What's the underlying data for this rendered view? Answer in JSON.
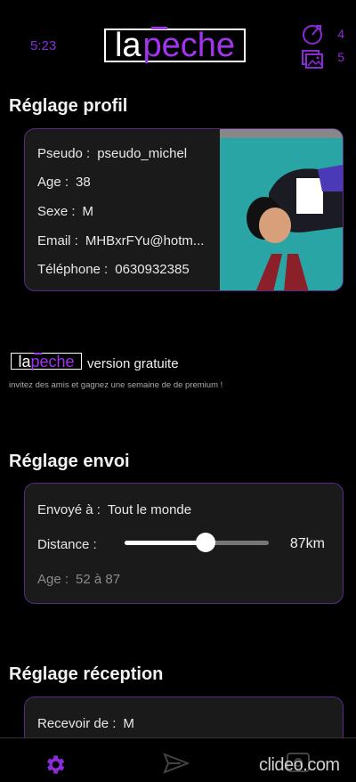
{
  "header": {
    "time": "5:23",
    "logo": {
      "part1": "la",
      "part2": "peche"
    },
    "counters": [
      {
        "icon": "boost-icon",
        "value": "4"
      },
      {
        "icon": "picture-icon",
        "value": "5"
      }
    ]
  },
  "profile": {
    "title": "Réglage profil",
    "fields": [
      {
        "label": "Pseudo :",
        "value": "pseudo_michel"
      },
      {
        "label": "Age :",
        "value": "38"
      },
      {
        "label": "Sexe :",
        "value": "M"
      },
      {
        "label": "Email :",
        "value": "MHBxrFYu@hotm..."
      },
      {
        "label": "Téléphone :",
        "value": "0630932385"
      }
    ]
  },
  "promo": {
    "logo": {
      "part1": "la",
      "part2": "peche"
    },
    "version": "version gratuite",
    "invite": "invitez des amis et gagnez une semaine de de premium !"
  },
  "send": {
    "title": "Réglage envoi",
    "sent_to": {
      "label": "Envoyé à :",
      "value": "Tout le monde"
    },
    "distance": {
      "label": "Distance :",
      "value": "87km",
      "fraction": 0.56
    },
    "age": {
      "label": "Age :",
      "value": "52 à 87"
    }
  },
  "receive": {
    "title": "Réglage réception",
    "receive_from": {
      "label": "Recevoir de :",
      "value": "M"
    }
  },
  "nav": {
    "items": [
      "settings-icon",
      "send-icon",
      "photo-icon"
    ],
    "active_color": "#8b2bd8"
  },
  "watermark": "clideo.com"
}
